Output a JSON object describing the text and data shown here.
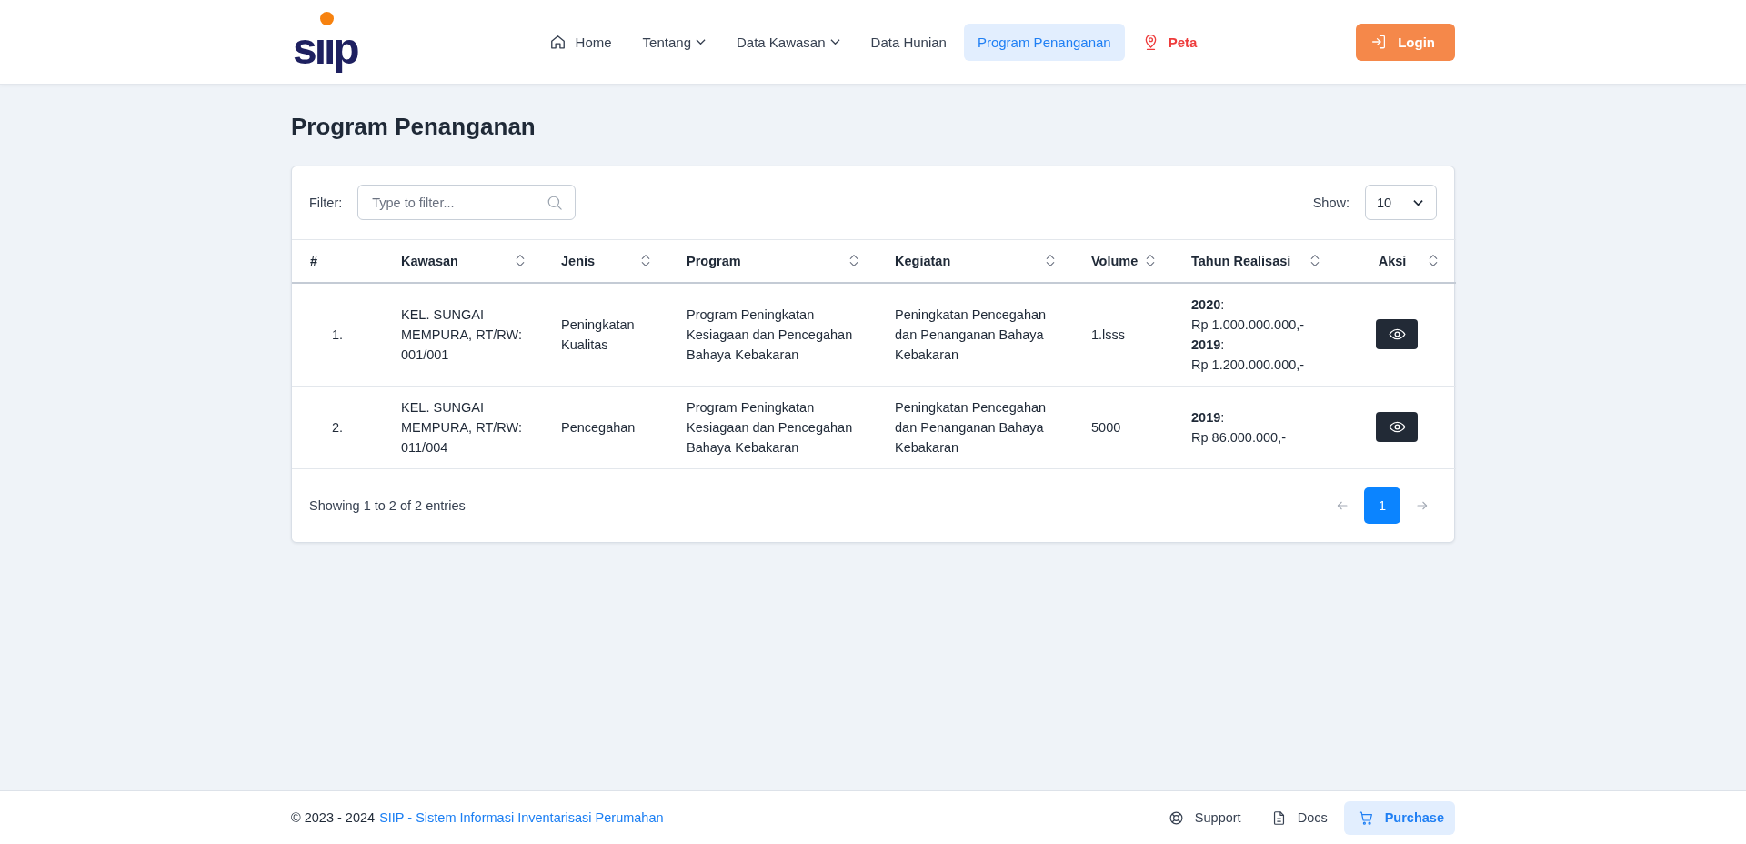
{
  "header": {
    "logo": {
      "text": "sııp"
    },
    "nav": [
      {
        "label": "Home",
        "kind": "home",
        "selected": false
      },
      {
        "label": "Tentang",
        "kind": "dropdown",
        "selected": false
      },
      {
        "label": "Data Kawasan",
        "kind": "dropdown",
        "selected": false
      },
      {
        "label": "Data Hunian",
        "kind": "link",
        "selected": false
      },
      {
        "label": "Program Penanganan",
        "kind": "link",
        "selected": true
      },
      {
        "label": "Peta",
        "kind": "map",
        "selected": false
      }
    ],
    "login_button": {
      "label": "Login"
    }
  },
  "page_title": "Program Penanganan",
  "table_card": {
    "filter": {
      "label": "Filter:",
      "placeholder": "Type to filter..."
    },
    "show": {
      "label": "Show:",
      "value": "10"
    },
    "columns": [
      {
        "label": "#",
        "sortable": false
      },
      {
        "label": "Kawasan",
        "sortable": true
      },
      {
        "label": "Jenis",
        "sortable": true
      },
      {
        "label": "Program",
        "sortable": true
      },
      {
        "label": "Kegiatan",
        "sortable": true
      },
      {
        "label": "Volume",
        "sortable": true
      },
      {
        "label": "Tahun Realisasi",
        "sortable": true
      },
      {
        "label": "Aksi",
        "sortable": true
      }
    ],
    "rows": [
      {
        "number": "1.",
        "kawasan": "KEL. SUNGAI MEMPURA, RT/RW: 001/001",
        "jenis": "Peningkatan Kualitas",
        "program": "Program Peningkatan Kesiagaan dan Pencegahan Bahaya Kebakaran",
        "kegiatan": "Peningkatan Pencegahan dan Penanganan Bahaya Kebakaran",
        "volume": "1.lsss",
        "tahun_realisasi": [
          "**2020**:",
          "Rp 1.000.000.000,-",
          "**2019**:",
          "Rp 1.200.000.000,-"
        ]
      },
      {
        "number": "2.",
        "kawasan": "KEL. SUNGAI MEMPURA, RT/RW: 011/004",
        "jenis": "Pencegahan",
        "program": "Program Peningkatan Kesiagaan dan Pencegahan Bahaya Kebakaran",
        "kegiatan": "Peningkatan Pencegahan dan Penanganan Bahaya Kebakaran",
        "volume": "5000",
        "tahun_realisasi": [
          "**2019**:",
          "Rp 86.000.000,-"
        ]
      }
    ],
    "summary": "Showing 1 to 2 of 2 entries",
    "pagination": {
      "previous": {
        "disabled": true
      },
      "pages": [
        {
          "label": "1",
          "selected": true
        }
      ],
      "next": {
        "disabled": true
      }
    }
  },
  "footer": {
    "copyright": "© 2023 - 2024",
    "link": "SIIP - Sistem Informasi Inventarisasi Perumahan",
    "links": [
      {
        "label": "Support",
        "kind": "support"
      },
      {
        "label": "Docs",
        "kind": "docs"
      },
      {
        "label": "Purchase",
        "kind": "purchase"
      }
    ]
  }
}
